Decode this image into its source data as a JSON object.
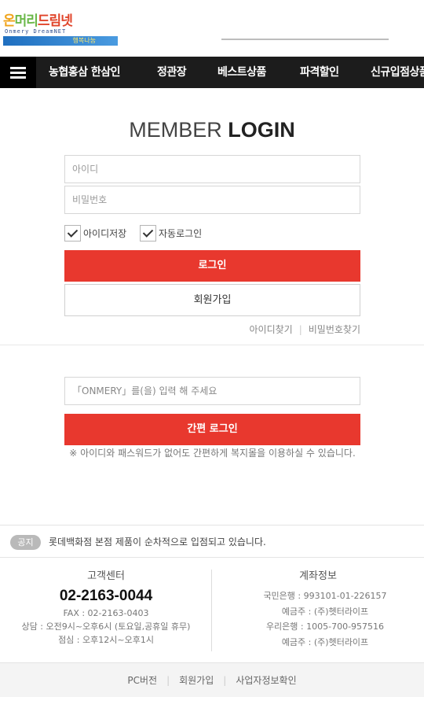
{
  "header": {
    "logo": {
      "main_1": "온",
      "main_2": "머리",
      "main_3": "드림넷",
      "sub": "Onmery DreamNET",
      "bar": "행복나눔"
    }
  },
  "nav": {
    "menu_icon": "hamburger-icon",
    "items": [
      "농협홍삼 한삼인",
      "정관장",
      "베스트상품",
      "파격할인",
      "신규입점상품"
    ]
  },
  "login": {
    "title_light": "MEMBER",
    "title_bold": "LOGIN",
    "id_placeholder": "아이디",
    "pw_placeholder": "비밀번호",
    "save_id_label": "아이디저장",
    "auto_login_label": "자동로그인",
    "login_button": "로그인",
    "join_button": "회원가입",
    "find_id": "아이디찾기",
    "find_separator": "|",
    "find_pw": "비밀번호찾기"
  },
  "easy_login": {
    "input_placeholder": "「ONMERY」를(을) 입력 해 주세요",
    "button": "간편 로그인",
    "note": "※ 아이디와 패스워드가 없어도 간편하게 복지몰을 이용하실 수 있습니다."
  },
  "notice": {
    "badge": "공지",
    "text": "롯데백화점 본점 제품이 순차적으로 입점되고 있습니다."
  },
  "customer_center": {
    "title": "고객센터",
    "phone": "02-2163-0044",
    "fax": "FAX : 02-2163-0403",
    "hours": "상담 : 오전9시~오후6시 (토요일,공휴일 휴무)",
    "lunch": "점심 : 오후12시~오후1시"
  },
  "account_info": {
    "title": "계좌정보",
    "lines": [
      "국민은행 : 993101-01-226157",
      "예금주 : (주)헷터라이프",
      "우리은행 : 1005-700-957516",
      "예금주 : (주)헷터라이프"
    ]
  },
  "footer": {
    "links": [
      "PC버전",
      "회원가입",
      "사업자정보확인"
    ],
    "separator": "|"
  },
  "colors": {
    "accent_red": "#e8382e",
    "nav_bg": "#1c1c1c"
  }
}
